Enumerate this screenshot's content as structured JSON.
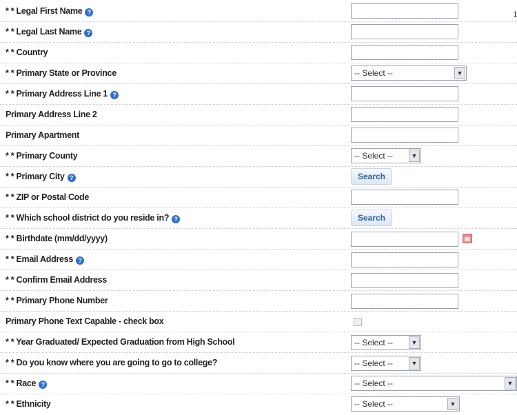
{
  "form": {
    "required_marker": "* *",
    "select_default": "-- Select --",
    "search_label": "Search",
    "fields": {
      "legal_first_name": {
        "label": "Legal First Name",
        "value": ""
      },
      "legal_last_name": {
        "label": "Legal Last Name",
        "value": ""
      },
      "country": {
        "label": "Country",
        "value": ""
      },
      "primary_state": {
        "label": "Primary State or Province",
        "selected": "-- Select --"
      },
      "primary_address_1": {
        "label": "Primary Address Line 1",
        "value": ""
      },
      "primary_address_2": {
        "label": "Primary Address Line 2",
        "value": ""
      },
      "primary_apartment": {
        "label": "Primary Apartment",
        "value": ""
      },
      "primary_county": {
        "label": "Primary County",
        "selected": "-- Select --"
      },
      "primary_city": {
        "label": "Primary City",
        "button": "Search"
      },
      "zip": {
        "label": "ZIP or Postal Code",
        "value": ""
      },
      "school_district": {
        "label": "Which school district do you reside in?",
        "button": "Search"
      },
      "birthdate": {
        "label": "Birthdate (mm/dd/yyyy)",
        "value": ""
      },
      "email": {
        "label": "Email Address",
        "value": ""
      },
      "confirm_email": {
        "label": "Confirm Email Address",
        "value": ""
      },
      "primary_phone": {
        "label": "Primary Phone Number",
        "value": ""
      },
      "phone_text_capable": {
        "label": "Primary Phone Text Capable - check box",
        "checked": false
      },
      "year_graduated": {
        "label": "Year Graduated/ Expected Graduation from High School",
        "selected": "-- Select --"
      },
      "college_plan": {
        "label": "Do you know where you are going to go to college?",
        "selected": "-- Select --"
      },
      "race": {
        "label": "Race",
        "selected": "-- Select --"
      },
      "ethnicity": {
        "label": "Ethnicity",
        "selected": "-- Select --"
      }
    }
  },
  "corner_text": "1",
  "colors": {
    "help_icon": "#2d6fd1",
    "button_text": "#2b5fa8",
    "calendar_icon": "#e88a8a"
  }
}
